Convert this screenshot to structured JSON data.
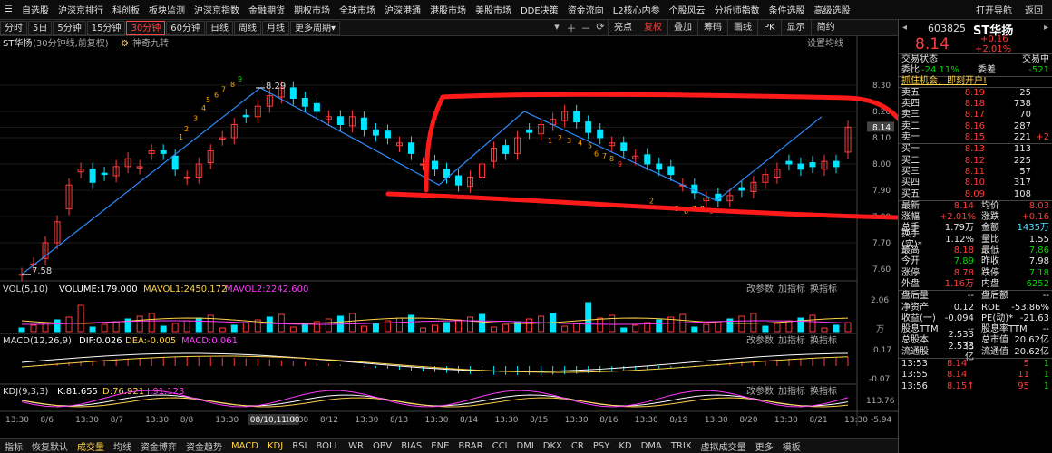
{
  "topnav": {
    "items": [
      "分时",
      "5日",
      "5分钟",
      "15分钟",
      "30分钟",
      "60分钟",
      "日线",
      "周线",
      "月线",
      "更多周期▾"
    ],
    "menu": [
      "自选股",
      "沪深京排行",
      "科创板",
      "板块监测",
      "沪深京指数",
      "金融期货",
      "期权市场",
      "全球市场",
      "沪深港通",
      "港股市场",
      "美股市场",
      "DDE决策",
      "资金流向",
      "L2核心内参",
      "个股风云",
      "分析师指数",
      "条件选股",
      "高级选股"
    ],
    "right": [
      "打开导航",
      "返回"
    ]
  },
  "toolbar": {
    "icons": [
      "▾",
      "＋",
      "－",
      "⟳"
    ],
    "buttons": [
      "亮点",
      "复权",
      "叠加",
      "筹码",
      "画线",
      "PK",
      "显示",
      "简约"
    ],
    "active_button": "复权"
  },
  "stock": {
    "code": "603825",
    "name": "ST华扬",
    "price": "8.14",
    "change": "+0.16",
    "change_pct": "+2.01%"
  },
  "main_chart": {
    "title": "ST华扬",
    "subtitle": "(30分钟线,前复权)",
    "indicator": "神奇九转",
    "settings": "设置均线",
    "price_labels": [
      "8.30",
      "8.20",
      "8.14",
      "8.10",
      "8.00",
      "7.90",
      "7.80",
      "7.70",
      "7.60"
    ],
    "high_label": "8.29",
    "low_label": "7.58",
    "current_label": "8.14"
  },
  "volume": {
    "label": "VOL(5,10)",
    "value": "VOLUME:179.000",
    "mavol1": "MAVOL1:2450.172",
    "mavol2": "MAVOL2:2242.600",
    "ticks": [
      "2.06",
      "万"
    ],
    "actions": [
      "改参数",
      "加指标",
      "换指标"
    ]
  },
  "macd": {
    "label": "MACD(12,26,9)",
    "dif": "DIF:0.026",
    "dea": "DEA:-0.005",
    "macd": "MACD:0.061",
    "ticks": [
      "0.17",
      "-0.07"
    ],
    "actions": [
      "改参数",
      "加指标",
      "换指标"
    ]
  },
  "kdj": {
    "label": "KDJ(9,3,3)",
    "k": "K:81.655",
    "d": "D:76.921",
    "j": "J:91.123",
    "ticks": [
      "113.76",
      "-5.94"
    ],
    "actions": [
      "改参数",
      "加指标",
      "换指标"
    ]
  },
  "time_axis": [
    "13:30",
    "8/6",
    "13:30",
    "8/7",
    "13:30",
    "8/8",
    "13:30",
    "08/10,11:00",
    "13:30",
    "8/12",
    "13:30",
    "8/13",
    "13:30",
    "8/14",
    "13:30",
    "8/15",
    "13:30",
    "8/16",
    "13:30",
    "8/19",
    "13:30",
    "8/20",
    "13:30",
    "8/21",
    "13:30"
  ],
  "bottombar": [
    "指标",
    "恢复默认",
    "成交量",
    "均线",
    "资金博弈",
    "资金趋势",
    "MACD",
    "KDJ",
    "RSI",
    "BOLL",
    "WR",
    "OBV",
    "BIAS",
    "ENE",
    "BRAR",
    "CCI",
    "DMI",
    "DKX",
    "CR",
    "PSY",
    "KD",
    "DMA",
    "TRIX",
    "虚拟成交量",
    "更多",
    "模板"
  ],
  "bottombar_selected": "成交量",
  "side": {
    "status_label": "交易状态",
    "status_value": "交易中",
    "weibi_label": "委比",
    "weibi_value": "-24.11%",
    "weicha_label": "委差",
    "weicha_value": "-521",
    "promo": "抓住机会，即刻开户!",
    "asks": [
      {
        "label": "卖五",
        "price": "8.19",
        "vol": "25",
        "chg": ""
      },
      {
        "label": "卖四",
        "price": "8.18",
        "vol": "738",
        "chg": ""
      },
      {
        "label": "卖三",
        "price": "8.17",
        "vol": "70",
        "chg": ""
      },
      {
        "label": "卖二",
        "price": "8.16",
        "vol": "287",
        "chg": ""
      },
      {
        "label": "卖一",
        "price": "8.15",
        "vol": "221",
        "chg": "+2"
      }
    ],
    "bids": [
      {
        "label": "买一",
        "price": "8.13",
        "vol": "113"
      },
      {
        "label": "买二",
        "price": "8.12",
        "vol": "225"
      },
      {
        "label": "买三",
        "price": "8.11",
        "vol": "57"
      },
      {
        "label": "买四",
        "price": "8.10",
        "vol": "317"
      },
      {
        "label": "买五",
        "price": "8.09",
        "vol": "108"
      }
    ],
    "stats": [
      {
        "l1": "最新",
        "v1": "8.14",
        "c1": "red",
        "l2": "均价",
        "v2": "8.03",
        "c2": "red"
      },
      {
        "l1": "涨幅",
        "v1": "+2.01%",
        "c1": "red",
        "l2": "涨跌",
        "v2": "+0.16",
        "c2": "red"
      },
      {
        "l1": "总手",
        "v1": "1.79万",
        "c1": "wht",
        "l2": "金额",
        "v2": "1435万",
        "c2": "cyan"
      },
      {
        "l1": "换手(实)*",
        "v1": "1.12%",
        "c1": "wht",
        "l2": "量比",
        "v2": "1.55",
        "c2": "wht"
      },
      {
        "l1": "最高",
        "v1": "8.18",
        "c1": "red",
        "l2": "最低",
        "v2": "7.86",
        "c2": "grn"
      },
      {
        "l1": "今开",
        "v1": "7.89",
        "c1": "grn",
        "l2": "昨收",
        "v2": "7.98",
        "c2": "wht"
      },
      {
        "l1": "涨停",
        "v1": "8.78",
        "c1": "red",
        "l2": "跌停",
        "v2": "7.18",
        "c2": "grn"
      },
      {
        "l1": "外盘",
        "v1": "1.16万",
        "c1": "red",
        "l2": "内盘",
        "v2": "6252",
        "c2": "grn"
      }
    ],
    "fin": [
      {
        "l1": "盘后量",
        "v1": "--",
        "l2": "盘后额",
        "v2": "--"
      },
      {
        "l1": "净资产",
        "v1": "0.12",
        "l2": "ROE",
        "v2": "-53.86%"
      },
      {
        "l1": "收益(一)",
        "v1": "-0.094",
        "l2": "PE(动)*",
        "v2": "-21.63"
      },
      {
        "l1": "股息TTM",
        "v1": "--",
        "l2": "股息率TTM",
        "v2": "--"
      },
      {
        "l1": "总股本",
        "v1": "2.533亿",
        "l2": "总市值",
        "v2": "20.62亿"
      },
      {
        "l1": "流通股",
        "v1": "2.533亿",
        "l2": "流通值",
        "v2": "20.62亿"
      }
    ],
    "ticks": [
      {
        "time": "13:53",
        "price": "8.14",
        "vol": "5",
        "flag": "1"
      },
      {
        "time": "13:55",
        "price": "8.14",
        "vol": "11",
        "flag": "1"
      },
      {
        "time": "13:56",
        "price": "8.15↑",
        "vol": "95",
        "flag": "1"
      }
    ]
  },
  "colors": {
    "up": "#ff3b3b",
    "down": "#00e5ff",
    "ma": "#2e8bff",
    "box": "#ff1a1a"
  }
}
